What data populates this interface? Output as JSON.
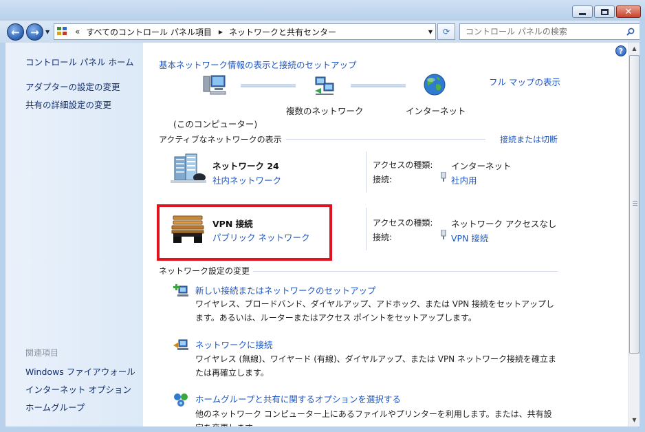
{
  "window": {
    "minimize_label": "",
    "maximize_label": "",
    "close_label": "✕"
  },
  "nav": {
    "back_icon": "arrow-left-icon",
    "forward_icon": "arrow-right-icon",
    "breadcrumb_prefix": "«",
    "breadcrumbs": [
      "すべてのコントロール パネル項目",
      "ネットワークと共有センター"
    ],
    "search_placeholder": "コントロール パネルの検索"
  },
  "sidebar": {
    "home": "コントロール パネル ホーム",
    "links": [
      "アダプターの設定の変更",
      "共有の詳細設定の変更"
    ],
    "related_heading": "関連項目",
    "related": [
      "Windows ファイアウォール",
      "インターネット オプション",
      "ホームグループ"
    ]
  },
  "main": {
    "title_link": "基本ネットワーク情報の表示と接続のセットアップ",
    "full_map_link": "フル マップの表示",
    "map": {
      "computer_label": "(このコンピューター)",
      "network_label": "複数のネットワーク",
      "internet_label": "インターネット"
    },
    "active_heading": "アクティブなネットワークの表示",
    "connect_disconnect_link": "接続または切断",
    "networks": [
      {
        "name": "ネットワーク  24",
        "category": "社内ネットワーク",
        "access_label": "アクセスの種類:",
        "access_value": "インターネット",
        "conn_label": "接続:",
        "conn_value": "社内用"
      },
      {
        "name": "VPN 接続",
        "category": "パブリック ネットワーク",
        "access_label": "アクセスの種類:",
        "access_value": "ネットワーク アクセスなし",
        "conn_label": "接続:",
        "conn_value": "VPN 接続"
      }
    ],
    "change_heading": "ネットワーク設定の変更",
    "tasks": [
      {
        "title": "新しい接続またはネットワークのセットアップ",
        "desc": "ワイヤレス、ブロードバンド、ダイヤルアップ、アドホック、または VPN 接続をセットアップします。あるいは、ルーターまたはアクセス ポイントをセットアップします。"
      },
      {
        "title": "ネットワークに接続",
        "desc": "ワイヤレス (無線)、ワイヤード (有線)、ダイヤルアップ、または VPN ネットワーク接続を確立または再確立します。"
      },
      {
        "title": "ホームグループと共有に関するオプションを選択する",
        "desc": "他のネットワーク コンピューター上にあるファイルやプリンターを利用します。または、共有設定を変更します。"
      }
    ]
  },
  "colors": {
    "link": "#1b56c6",
    "highlight_box": "#e0121d",
    "sidebar_bg": "#e4eef9"
  }
}
